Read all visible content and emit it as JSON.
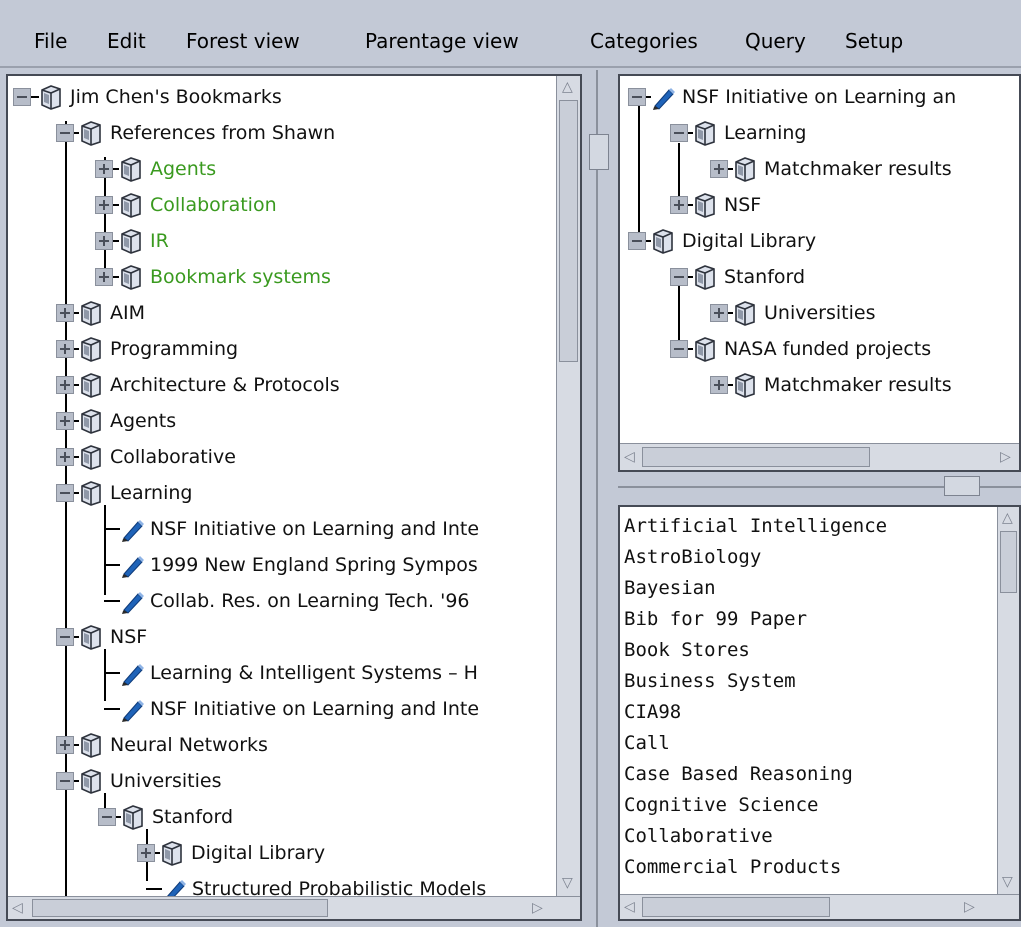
{
  "menu": {
    "file": "File",
    "edit": "Edit",
    "forest_view": "Forest view",
    "parentage_view": "Parentage view",
    "categories": "Categories",
    "query": "Query",
    "setup": "Setup"
  },
  "left_tree": {
    "root": "Jim Chen's Bookmarks",
    "references": "References from Shawn",
    "ref_agents": "Agents",
    "ref_collaboration": "Collaboration",
    "ref_ir": "IR",
    "ref_bookmark_systems": "Bookmark systems",
    "aim": "AIM",
    "programming": "Programming",
    "architecture": "Architecture & Protocols",
    "agents": "Agents",
    "collaborative": "Collaborative",
    "learning": "Learning",
    "learning_bm1": "NSF Initiative on Learning and Inte",
    "learning_bm2": "1999 New England Spring Sympos",
    "learning_bm3": "Collab. Res. on Learning Tech. '96",
    "nsf": "NSF",
    "nsf_bm1": "Learning & Intelligent Systems – H",
    "nsf_bm2": "NSF Initiative on Learning and Inte",
    "neural_networks": "Neural Networks",
    "universities": "Universities",
    "stanford": "Stanford",
    "digital_library": "Digital Library",
    "structured": "Structured Probabilistic Models"
  },
  "parentage_tree": {
    "root_bm": "NSF Initiative on Learning an",
    "learning": "Learning",
    "matchmaker1": "Matchmaker results",
    "nsf": "NSF",
    "digital_library": "Digital Library",
    "stanford": "Stanford",
    "universities": "Universities",
    "nasa": "NASA funded projects",
    "matchmaker2": "Matchmaker results"
  },
  "categories": [
    "Artificial Intelligence",
    "AstroBiology",
    "Bayesian",
    "Bib for 99 Paper",
    "Book Stores",
    "Business System",
    "CIA98",
    "Call",
    "Case Based Reasoning",
    "Cognitive Science",
    "Collaborative",
    "Commercial Products"
  ],
  "colors": {
    "background": "#c3c9d6",
    "category_highlight": "#3a9a1f",
    "folder": "#4b5361",
    "bookmark_pen": "#1f63b8"
  },
  "icons": {
    "folder": "folder-icon",
    "bookmark": "bookmark-pen-icon",
    "expand": "plus-box-icon",
    "collapse": "minus-box-icon"
  }
}
